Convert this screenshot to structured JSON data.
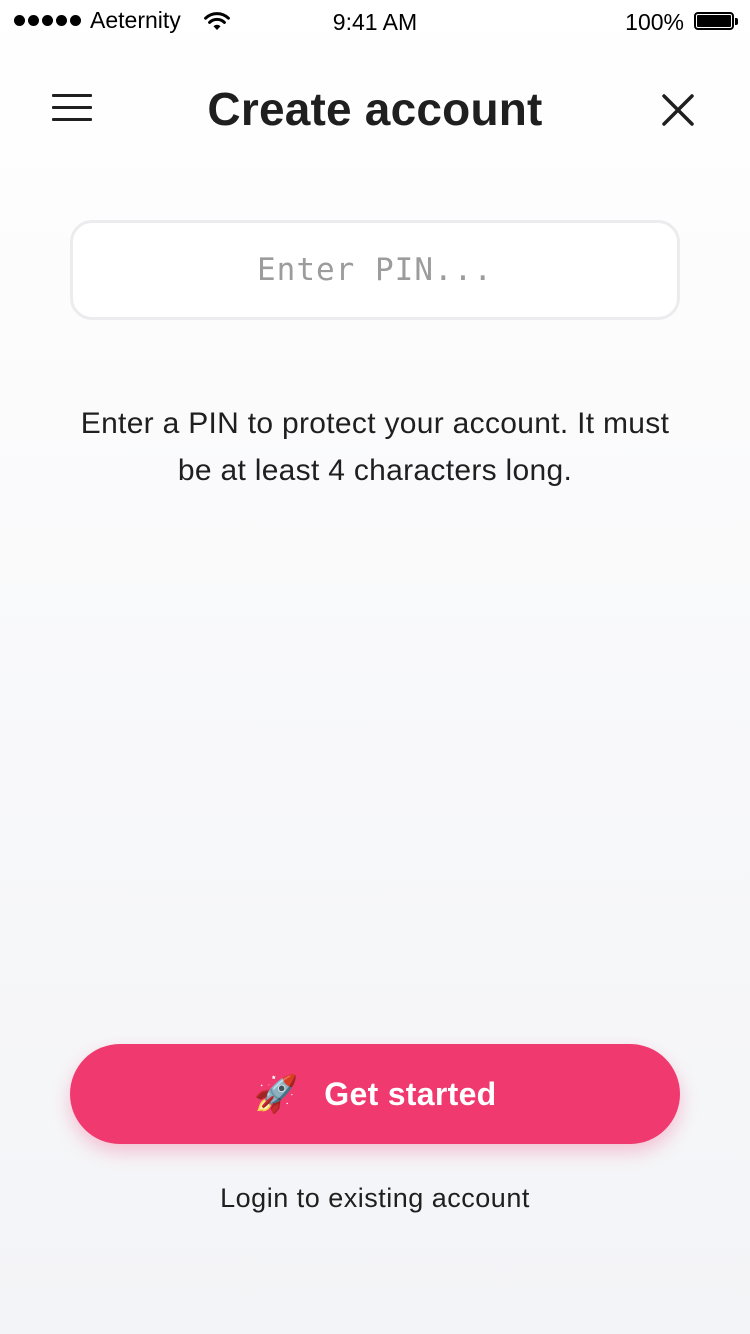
{
  "status_bar": {
    "carrier": "Aeternity",
    "time": "9:41 AM",
    "battery_percent": "100%",
    "battery_level": 1.0,
    "signal_bars": 5
  },
  "header": {
    "title": "Create account",
    "menu_icon": "hamburger-menu-icon",
    "close_icon": "close-icon"
  },
  "pin": {
    "placeholder": "Enter PIN...",
    "value": ""
  },
  "instruction": "Enter a PIN to protect your account. It must be at least 4 characters long.",
  "actions": {
    "get_started_icon": "🚀",
    "get_started_label": "Get started",
    "login_label": "Login to existing account"
  },
  "colors": {
    "accent": "#f0396f",
    "text": "#1f1f1f",
    "placeholder": "#9c9c9c",
    "input_border": "#ececef"
  }
}
